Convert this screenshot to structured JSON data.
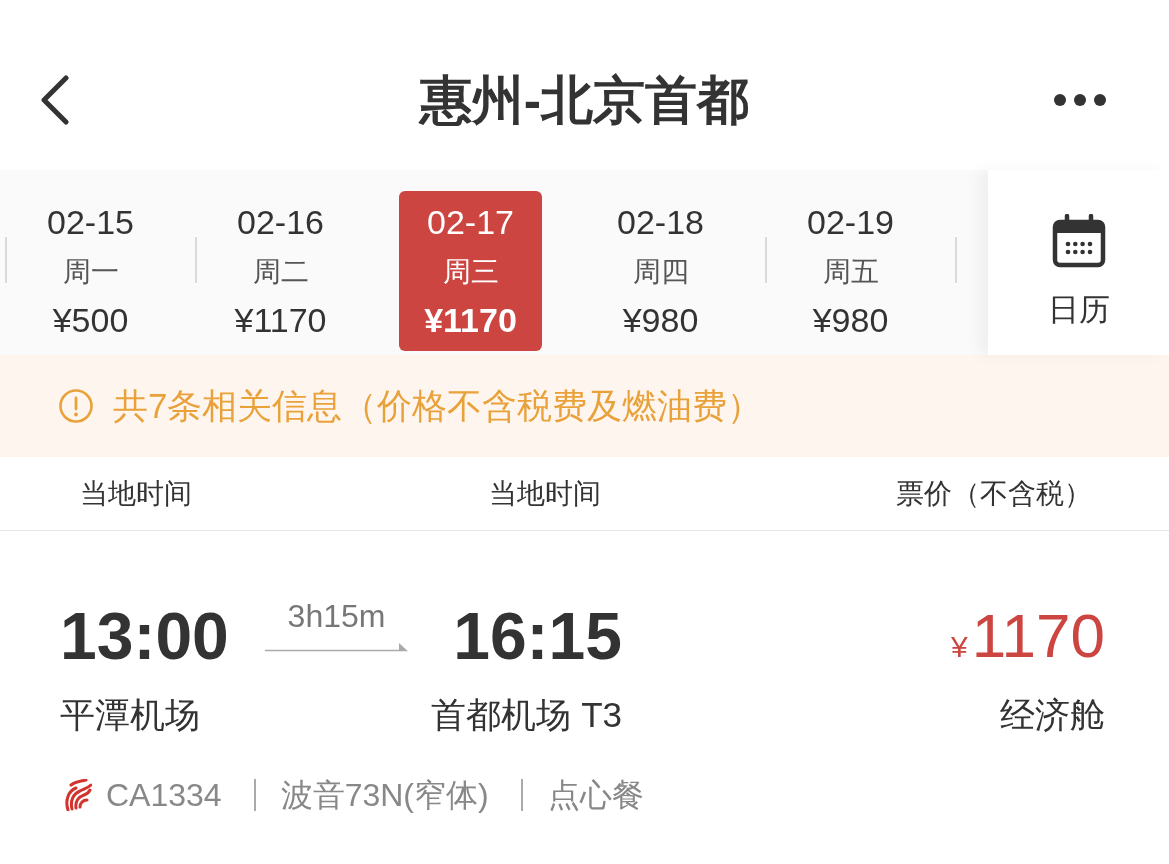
{
  "nav": {
    "title": "惠州-北京首都"
  },
  "dates": [
    {
      "date": "02-15",
      "weekday": "周一",
      "price": "¥500",
      "selected": false
    },
    {
      "date": "02-16",
      "weekday": "周二",
      "price": "¥1170",
      "selected": false
    },
    {
      "date": "02-17",
      "weekday": "周三",
      "price": "¥1170",
      "selected": true
    },
    {
      "date": "02-18",
      "weekday": "周四",
      "price": "¥980",
      "selected": false
    },
    {
      "date": "02-19",
      "weekday": "周五",
      "price": "¥980",
      "selected": false
    }
  ],
  "calendar": {
    "label": "日历"
  },
  "notice": {
    "text": "共7条相关信息（价格不含税费及燃油费）"
  },
  "columns": [
    "当地时间",
    "当地时间",
    "票价（不含税）"
  ],
  "flights": [
    {
      "departure_time": "13:00",
      "duration": "3h15m",
      "arrival_time": "16:15",
      "currency": "¥",
      "price": "1170",
      "departure_airport": "平潭机场",
      "arrival_airport": "首都机场 T3",
      "cabin": "经济舱",
      "flight_number": "CA1334",
      "aircraft": "波音73N(窄体)",
      "meal": "点心餐"
    }
  ]
}
